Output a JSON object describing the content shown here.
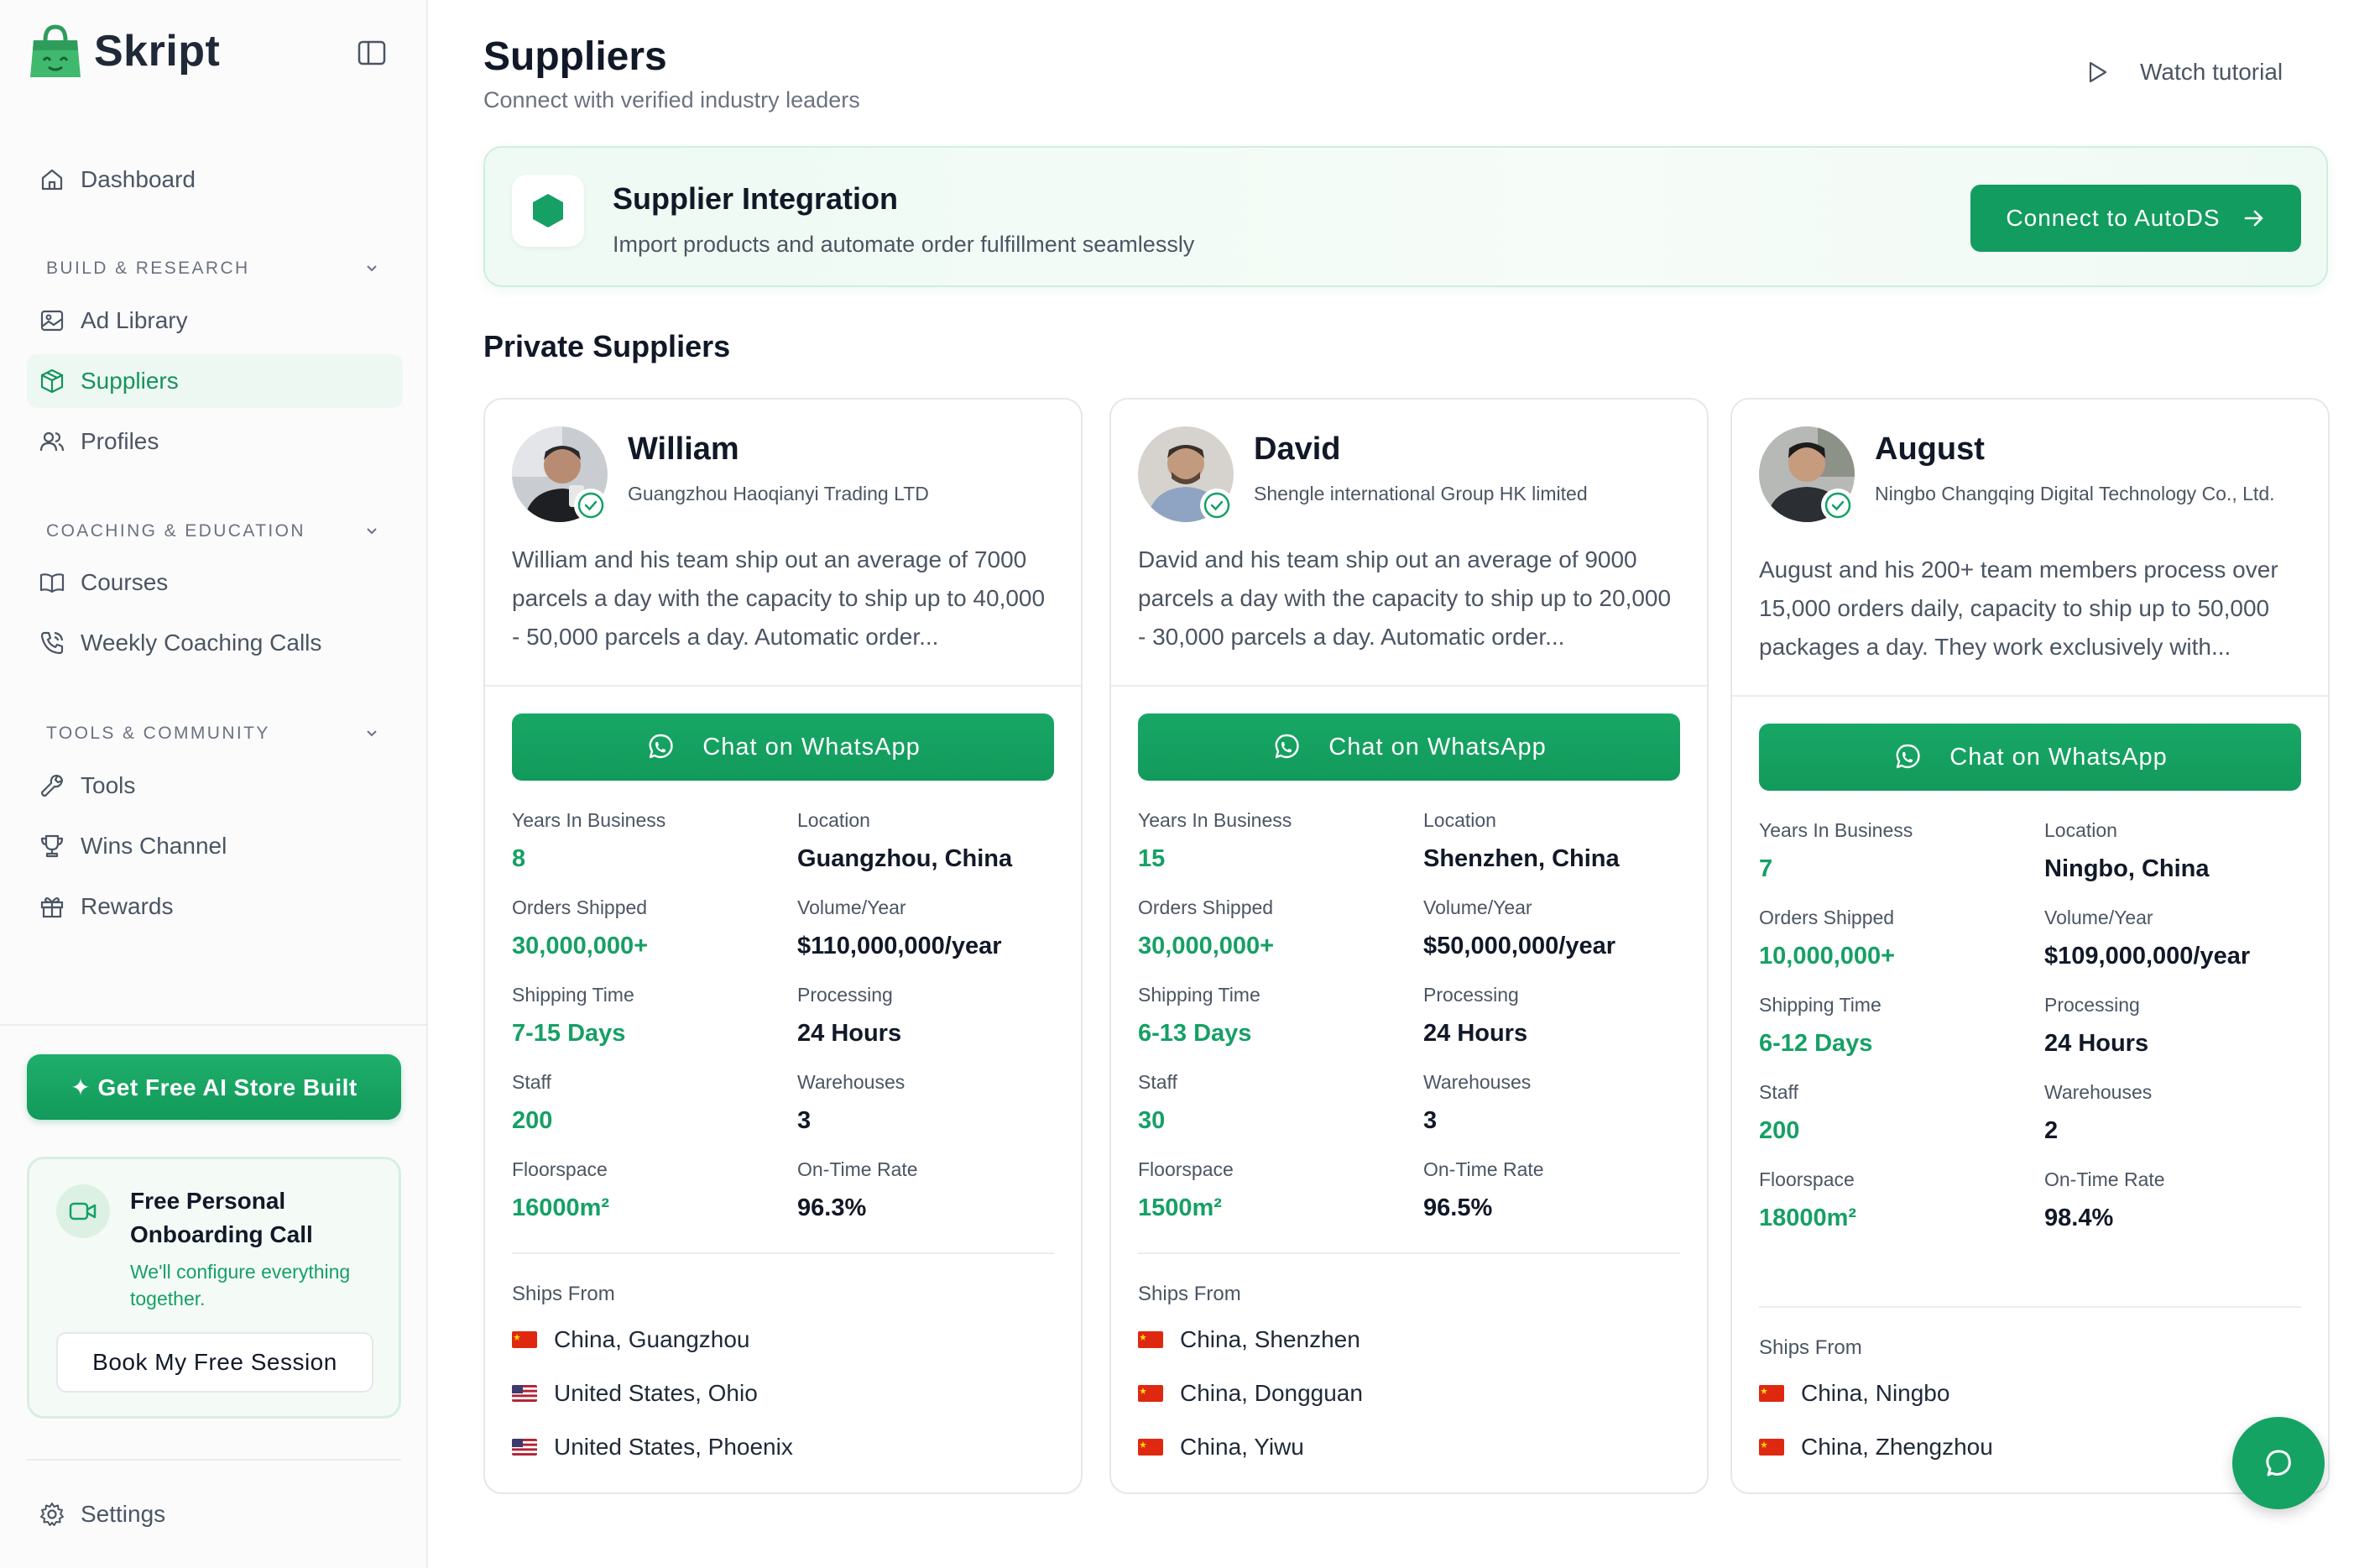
{
  "app": {
    "name": "Skript"
  },
  "sidebar": {
    "dashboard": "Dashboard",
    "sections": [
      {
        "label": "BUILD & RESEARCH",
        "items": [
          "Ad Library",
          "Suppliers",
          "Profiles"
        ]
      },
      {
        "label": "COACHING & EDUCATION",
        "items": [
          "Courses",
          "Weekly Coaching Calls"
        ]
      },
      {
        "label": "TOOLS & COMMUNITY",
        "items": [
          "Tools",
          "Wins Channel",
          "Rewards"
        ]
      }
    ],
    "active_item": "Suppliers",
    "ai_button": "✦ Get Free AI Store Built",
    "onboarding": {
      "title": "Free Personal Onboarding Call",
      "subtitle": "We'll configure everything together.",
      "button": "Book My Free Session"
    },
    "settings": "Settings"
  },
  "header": {
    "title": "Suppliers",
    "subtitle": "Connect with verified industry leaders",
    "watch_tutorial": "Watch tutorial"
  },
  "banner": {
    "title": "Supplier Integration",
    "subtitle": "Import products and automate order fulfillment seamlessly",
    "button": "Connect to AutoDS"
  },
  "section_title": "Private Suppliers",
  "labels": {
    "years": "Years In Business",
    "location": "Location",
    "orders": "Orders Shipped",
    "volume": "Volume/Year",
    "shipping": "Shipping Time",
    "processing": "Processing",
    "staff": "Staff",
    "warehouses": "Warehouses",
    "floorspace": "Floorspace",
    "ontime": "On-Time Rate",
    "ships_from": "Ships From",
    "chat": "Chat on WhatsApp"
  },
  "suppliers": [
    {
      "name": "William",
      "company": "Guangzhou Haoqianyi Trading LTD",
      "description": "William and his team ship out an average of 7000 parcels a day with the capacity to ship up to 40,000 - 50,000 parcels a day. Automatic order...",
      "years": "8",
      "location": "Guangzhou, China",
      "orders": "30,000,000+",
      "volume": "$110,000,000/year",
      "shipping": "7-15 Days",
      "processing": "24 Hours",
      "staff": "200",
      "warehouses": "3",
      "floorspace": "16000m²",
      "ontime": "96.3%",
      "ships_from": [
        {
          "flag": "cn-flag",
          "place": "China, Guangzhou"
        },
        {
          "flag": "us-flag",
          "place": "United States, Ohio"
        },
        {
          "flag": "us-flag",
          "place": "United States, Phoenix"
        }
      ]
    },
    {
      "name": "David",
      "company": "Shengle international Group HK limited",
      "description": "David and his team ship out an average of 9000 parcels a day with the capacity to ship up to 20,000 - 30,000 parcels a day. Automatic order...",
      "years": "15",
      "location": "Shenzhen, China",
      "orders": "30,000,000+",
      "volume": "$50,000,000/year",
      "shipping": "6-13 Days",
      "processing": "24 Hours",
      "staff": "30",
      "warehouses": "3",
      "floorspace": "1500m²",
      "ontime": "96.5%",
      "ships_from": [
        {
          "flag": "cn-flag",
          "place": "China, Shenzhen"
        },
        {
          "flag": "cn-flag",
          "place": "China, Dongguan"
        },
        {
          "flag": "cn-flag",
          "place": "China, Yiwu"
        }
      ]
    },
    {
      "name": "August",
      "company": "Ningbo Changqing Digital Technology Co., Ltd.",
      "description": "August and his 200+ team members process over 15,000 orders daily, capacity to ship up to 50,000 packages a day. They work exclusively with...",
      "years": "7",
      "location": "Ningbo, China",
      "orders": "10,000,000+",
      "volume": "$109,000,000/year",
      "shipping": "6-12 Days",
      "processing": "24 Hours",
      "staff": "200",
      "warehouses": "2",
      "floorspace": "18000m²",
      "ontime": "98.4%",
      "ships_from": [
        {
          "flag": "cn-flag",
          "place": "China, Ningbo"
        },
        {
          "flag": "cn-flag",
          "place": "China, Zhengzhou"
        }
      ]
    }
  ],
  "colors": {
    "accent": "#16a065",
    "accent_dark": "#129c5f",
    "text": "#111827",
    "muted": "#4b5563"
  }
}
